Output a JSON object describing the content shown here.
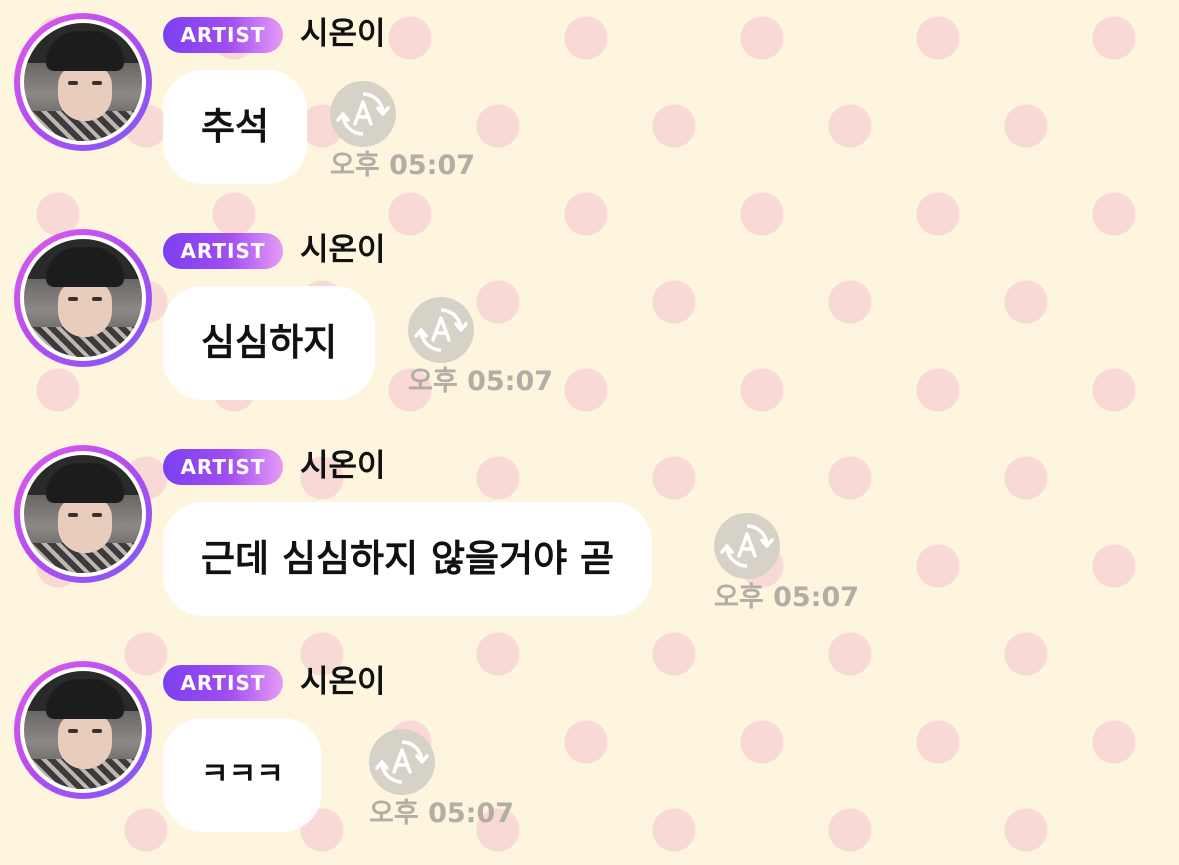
{
  "chat": {
    "messages": [
      {
        "badge": "ARTIST",
        "sender": "시온이",
        "text": "추석",
        "time": "오후 05:07",
        "translate_icon": "translate-icon"
      },
      {
        "badge": "ARTIST",
        "sender": "시온이",
        "text": "심심하지",
        "time": "오후 05:07",
        "translate_icon": "translate-icon"
      },
      {
        "badge": "ARTIST",
        "sender": "시온이",
        "text": "근데 심심하지 않을거야 곧",
        "time": "오후 05:07",
        "translate_icon": "translate-icon"
      },
      {
        "badge": "ARTIST",
        "sender": "시온이",
        "text": "ㅋㅋㅋ",
        "time": "오후 05:07",
        "translate_icon": "translate-icon"
      }
    ]
  },
  "colors": {
    "background": "#fdf5dd",
    "polka_dot": "#f8d9d6",
    "badge_start": "#7b3ff0",
    "badge_end": "#e59bf6",
    "avatar_ring": "#b24cf0",
    "bubble": "#ffffff",
    "timestamp": "#b2ada5"
  }
}
